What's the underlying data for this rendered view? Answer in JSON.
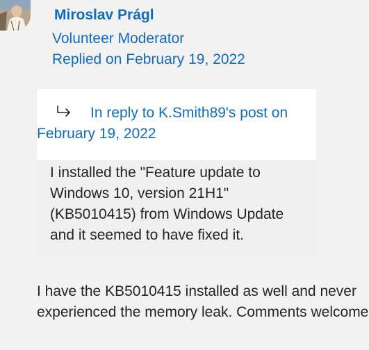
{
  "post": {
    "author": {
      "name": "Miroslav Prágl",
      "role": "Volunteer Moderator",
      "avatar_icon": "user-avatar-photo"
    },
    "reply_date": "Replied on February 19, 2022",
    "in_reply_to": {
      "icon": "reply-arrow-icon",
      "text": "In reply to K.Smith89's post on February 19, 2022"
    },
    "quote": {
      "text": "I installed the \"Feature update to Windows 10, version 21H1\" (KB5010415) from Windows Update and it seemed to have fixed it."
    },
    "body": "I have the KB5010415 installed as well and never experienced the memory leak. Comments welcome"
  },
  "colors": {
    "link": "#0f6cbd",
    "text": "#242424",
    "background": "#f3f2f1",
    "quote_header_bg": "#ffffff",
    "quote_body_bg": "#f0f0f0"
  }
}
